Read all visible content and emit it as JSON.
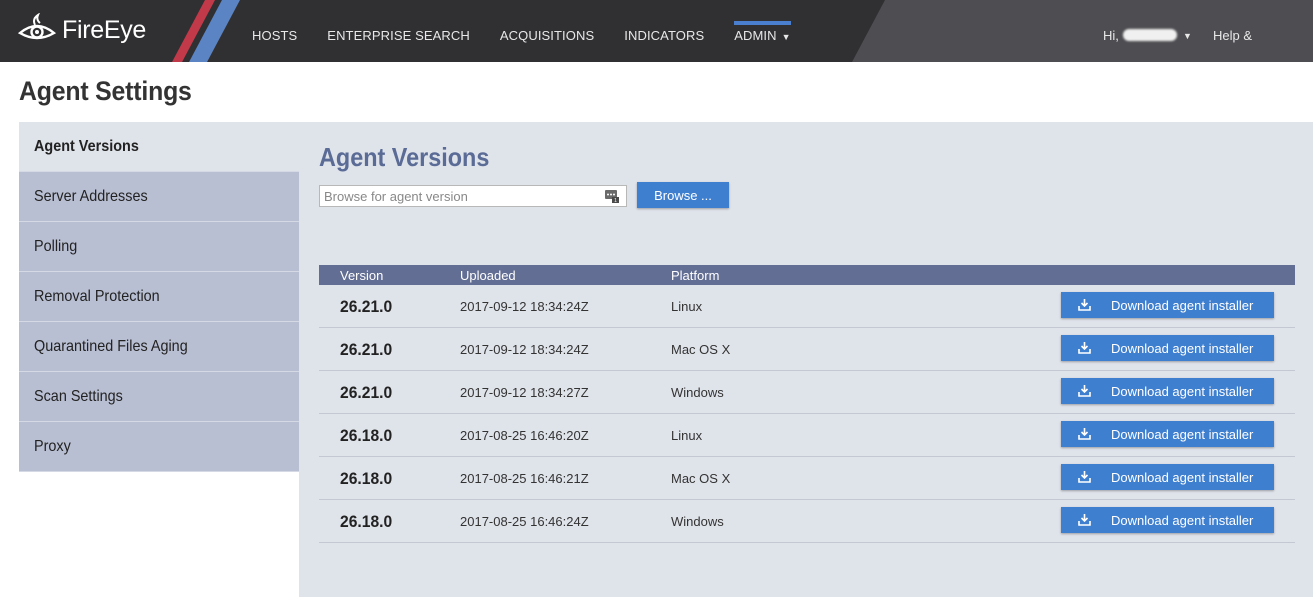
{
  "app": {
    "logo_text": "FireEye",
    "nav": [
      {
        "label": "HOSTS",
        "active": false
      },
      {
        "label": "ENTERPRISE SEARCH",
        "active": false
      },
      {
        "label": "ACQUISITIONS",
        "active": false
      },
      {
        "label": "INDICATORS",
        "active": false
      },
      {
        "label": "ADMIN",
        "active": true,
        "has_dropdown": true
      }
    ],
    "user_greeting": "Hi,",
    "help_label": "Help & Support"
  },
  "page": {
    "title": "Agent Settings"
  },
  "sidebar": {
    "items": [
      {
        "label": "Agent Versions",
        "active": true
      },
      {
        "label": "Server Addresses",
        "active": false
      },
      {
        "label": "Polling",
        "active": false
      },
      {
        "label": "Removal Protection",
        "active": false
      },
      {
        "label": "Quarantined Files Aging",
        "active": false
      },
      {
        "label": "Scan Settings",
        "active": false
      },
      {
        "label": "Proxy",
        "active": false
      }
    ]
  },
  "main": {
    "title": "Agent Versions",
    "browse_placeholder": "Browse for agent version",
    "browse_button": "Browse ...",
    "table": {
      "columns": [
        "Version",
        "Uploaded",
        "Platform"
      ],
      "rows": [
        {
          "version": "26.21.0",
          "uploaded": "2017-09-12 18:34:24Z",
          "platform": "Linux",
          "action": "Download agent installer"
        },
        {
          "version": "26.21.0",
          "uploaded": "2017-09-12 18:34:24Z",
          "platform": "Mac OS X",
          "action": "Download agent installer"
        },
        {
          "version": "26.21.0",
          "uploaded": "2017-09-12 18:34:27Z",
          "platform": "Windows",
          "action": "Download agent installer"
        },
        {
          "version": "26.18.0",
          "uploaded": "2017-08-25 16:46:20Z",
          "platform": "Linux",
          "action": "Download agent installer"
        },
        {
          "version": "26.18.0",
          "uploaded": "2017-08-25 16:46:21Z",
          "platform": "Mac OS X",
          "action": "Download agent installer"
        },
        {
          "version": "26.18.0",
          "uploaded": "2017-08-25 16:46:24Z",
          "platform": "Windows",
          "action": "Download agent installer"
        }
      ]
    }
  },
  "colors": {
    "topbar": "#303033",
    "accent_blue": "#3f7fd0",
    "table_header": "#636e94",
    "sidebar_item": "#b9bfd3",
    "main_bg": "#dfe3ea"
  },
  "icons": {
    "logo": "fireeye-eye-icon",
    "file_picker": "file-picker-icon",
    "download": "download-icon",
    "dropdown": "caret-down-icon"
  }
}
